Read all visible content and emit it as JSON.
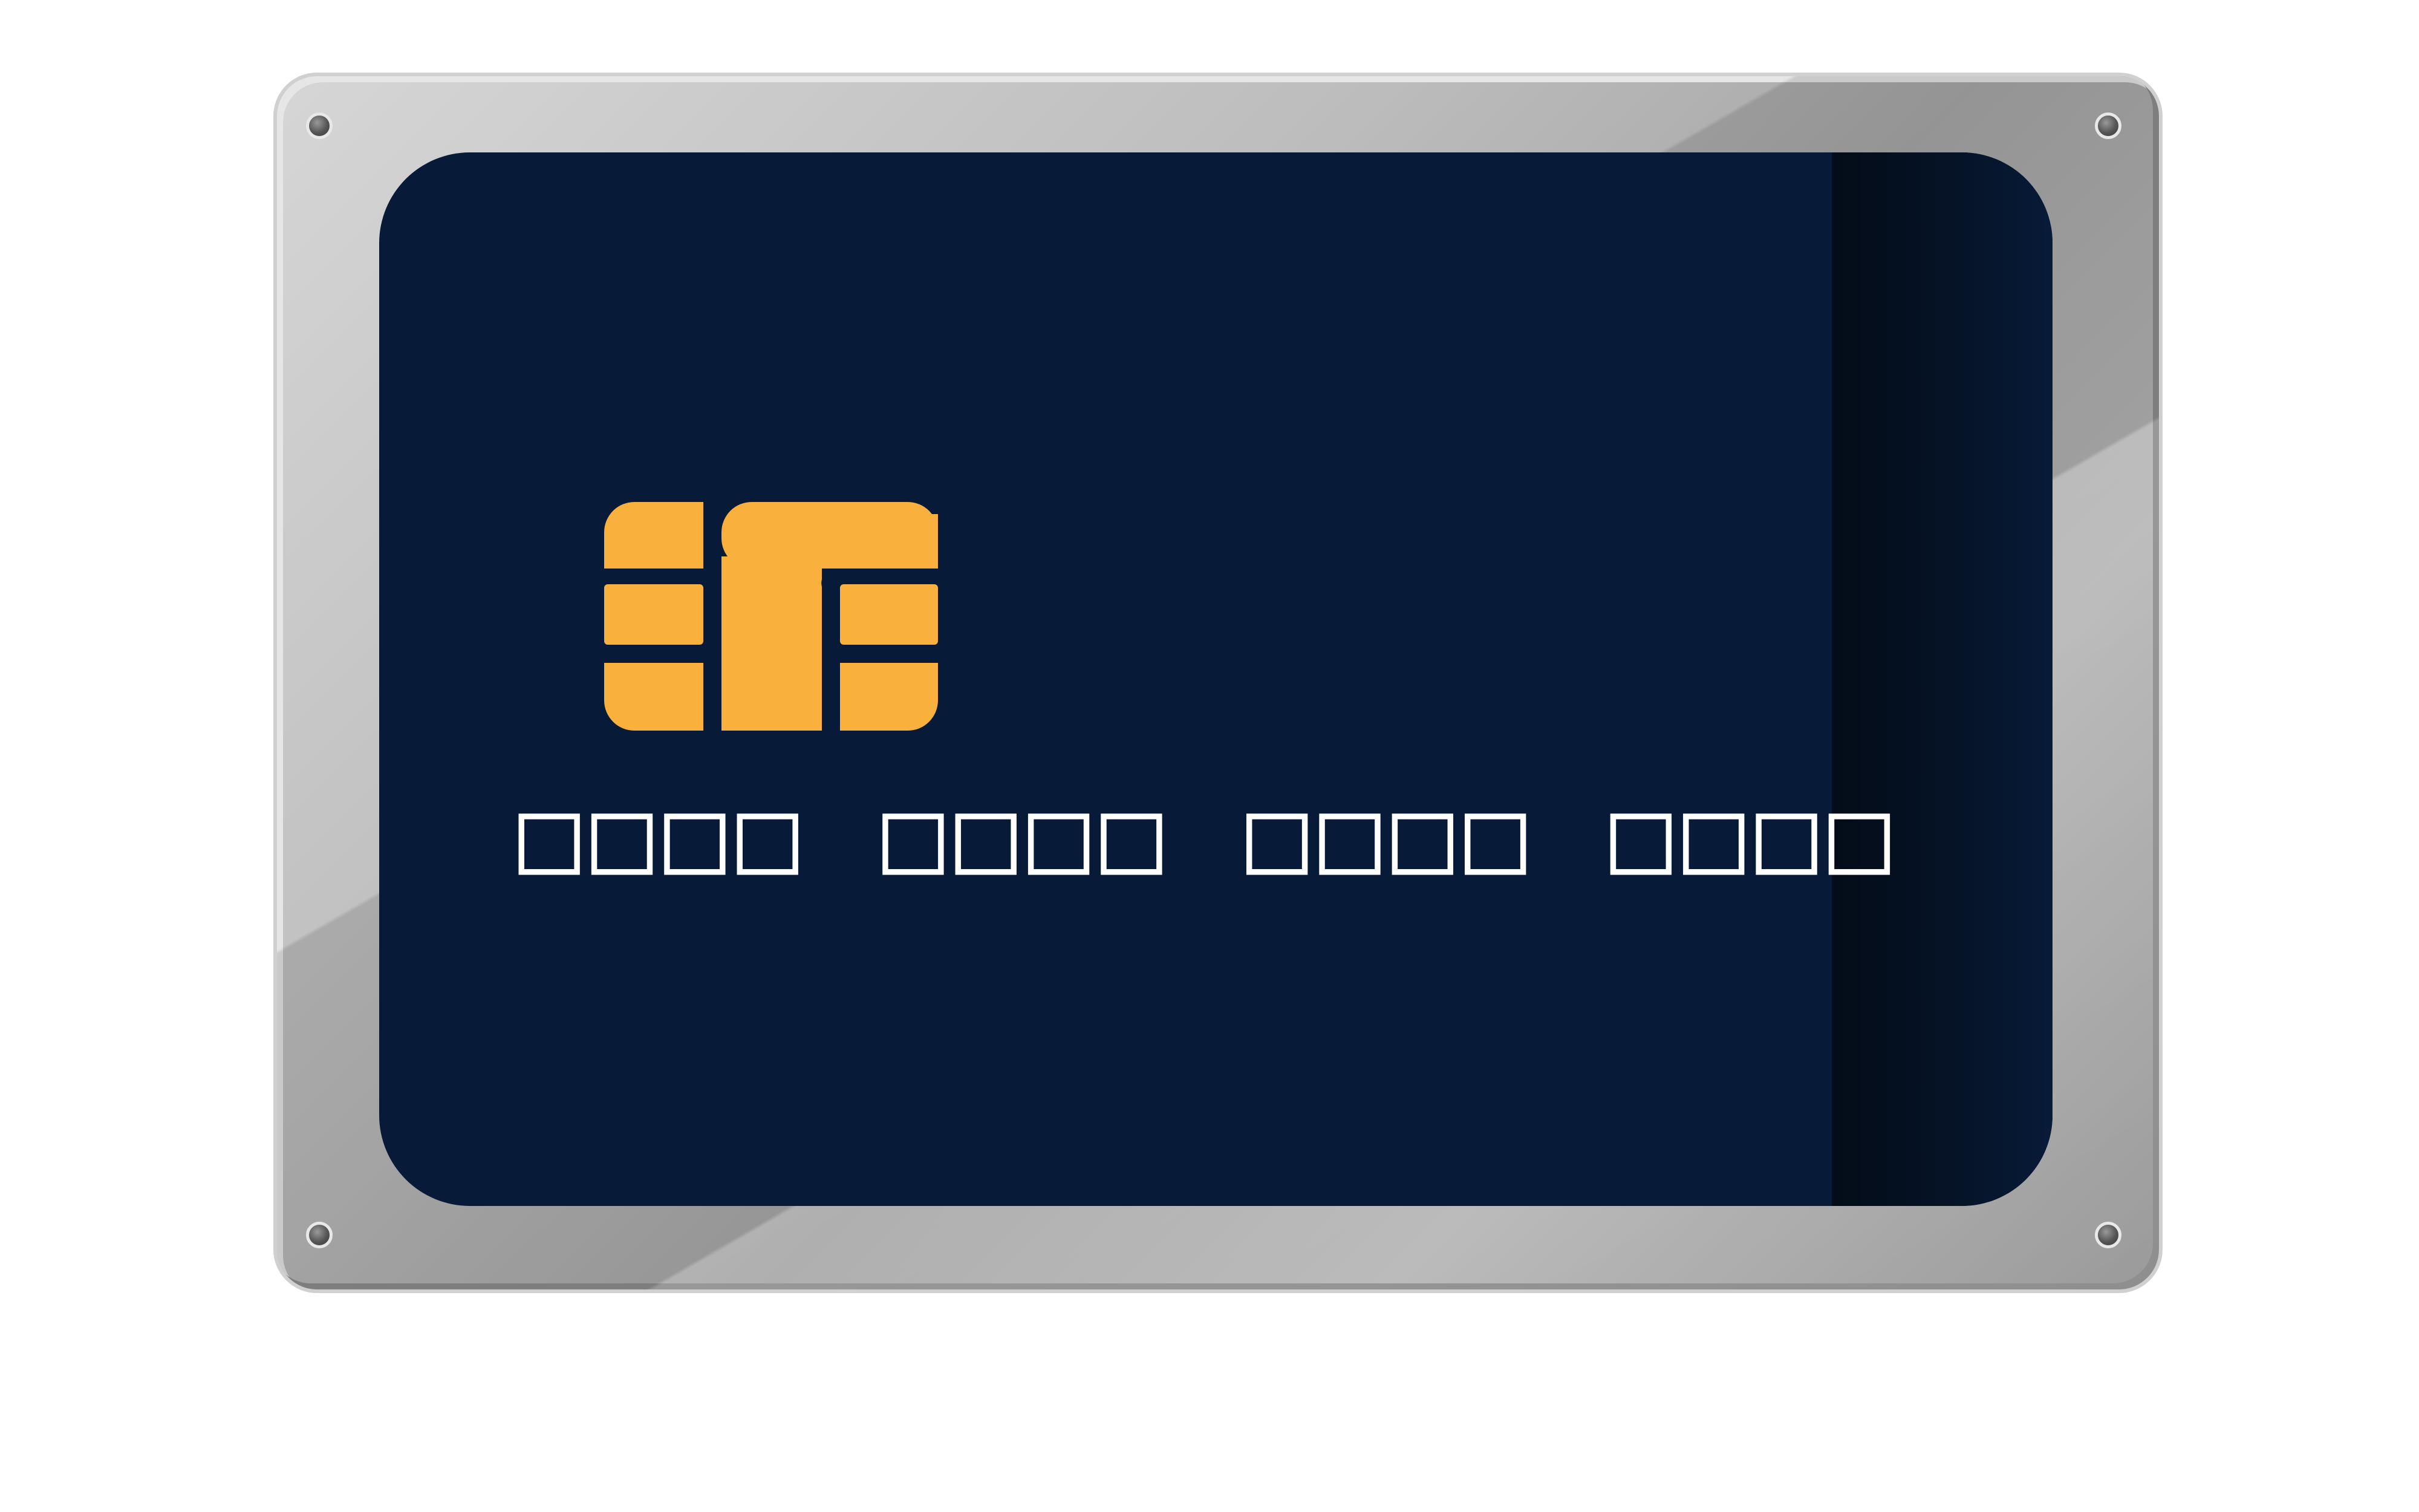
{
  "card": {
    "number_text": "□□□□ □□□□ □□□□ □□□□",
    "background_color": "#071a38",
    "chip_color": "#f9b03d",
    "plate_color": "#bdbdbd"
  },
  "icons": {
    "chip": "emv-chip-icon",
    "screws": "screw-icon"
  }
}
